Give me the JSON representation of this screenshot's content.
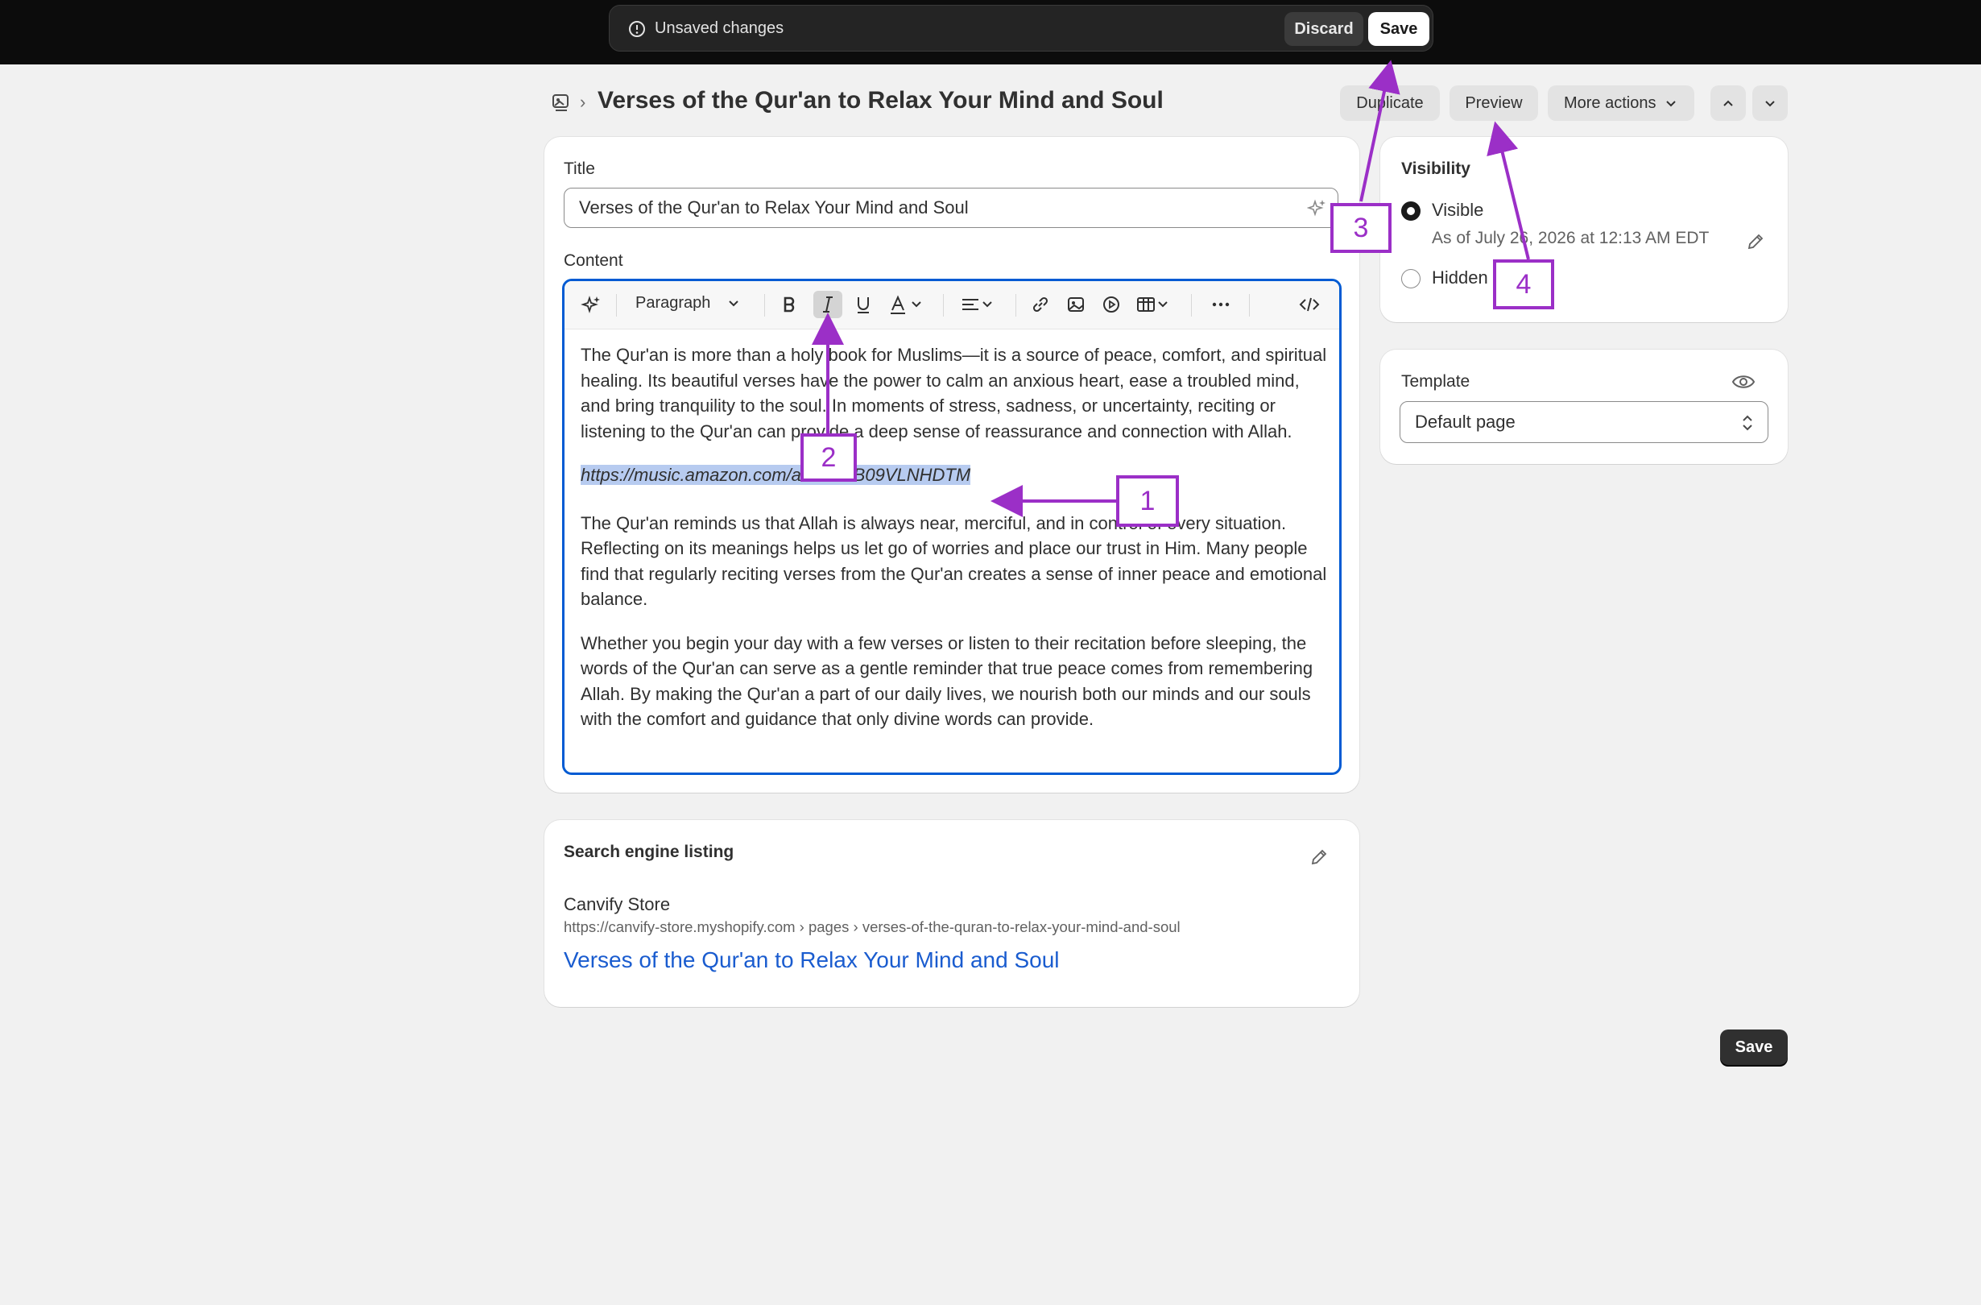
{
  "topbar": {
    "message": "Unsaved changes",
    "discard_label": "Discard",
    "save_label": "Save"
  },
  "header": {
    "title": "Verses of the Qur'an to Relax Your Mind and Soul",
    "duplicate_label": "Duplicate",
    "preview_label": "Preview",
    "more_actions_label": "More actions"
  },
  "form": {
    "title_label": "Title",
    "title_value": "Verses of the Qur'an to Relax Your Mind and Soul",
    "content_label": "Content",
    "toolbar": {
      "paragraph_label": "Paragraph"
    },
    "paragraphs": [
      "The Qur'an is more than a holy book for Muslims—it is a source of peace, comfort, and spiritual healing. Its beautiful verses have the power to calm an anxious heart, ease a troubled mind, and bring tranquility to the soul. In moments of stress, sadness, or uncertainty, reciting or listening to the Qur'an can provide a deep sense of reassurance and connection with Allah.",
      "The Qur'an reminds us that Allah is always near, merciful, and in control of every situation. Reflecting on its meanings helps us let go of worries and place our trust in Him. Many people find that regularly reciting verses from the Qur'an creates a sense of inner peace and emotional balance.",
      "Whether you begin your day with a few verses or listen to their recitation before sleeping, the words of the Qur'an can serve as a gentle reminder that true peace comes from remembering Allah. By making the Qur'an a part of our daily lives, we nourish both our minds and our souls with the comfort and guidance that only divine words can provide."
    ],
    "selected_link": "https://music.amazon.com/albums/B09VLNHDTM"
  },
  "seo": {
    "heading": "Search engine listing",
    "store_name": "Canvify Store",
    "url": "https://canvify-store.myshopify.com › pages › verses-of-the-quran-to-relax-your-mind-and-soul",
    "link_title": "Verses of the Qur'an to Relax Your Mind and Soul"
  },
  "visibility": {
    "heading": "Visibility",
    "visible_label": "Visible",
    "visible_date": "As of July 26, 2026 at 12:13 AM EDT",
    "hidden_label": "Hidden"
  },
  "template": {
    "heading": "Template",
    "selected": "Default page"
  },
  "footer": {
    "save_label": "Save"
  },
  "annotations": {
    "one": "1",
    "two": "2",
    "three": "3",
    "four": "4",
    "color": "#9b2fc7"
  }
}
